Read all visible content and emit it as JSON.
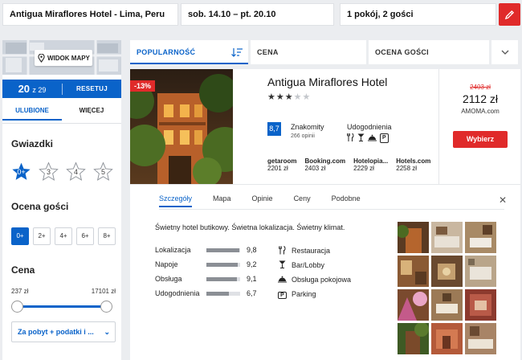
{
  "search": {
    "location": "Antigua Miraflores Hotel - Lima, Peru",
    "dates": "sob. 14.10  –  pt. 20.10",
    "rooms": "1 pokój, 2 gości"
  },
  "sidebar": {
    "map_button": "WIDOK MAPY",
    "count_current": "20",
    "count_total": "z 29",
    "reset_label": "RESETUJ",
    "tabs": [
      {
        "label": "ULUBIONE",
        "active": true
      },
      {
        "label": "WIĘCEJ",
        "active": false
      }
    ],
    "stars_title": "Gwiazdki",
    "stars": [
      "0+",
      "3",
      "4",
      "5"
    ],
    "rating_title": "Ocena gości",
    "ratings": [
      "0+",
      "2+",
      "4+",
      "6+",
      "8+"
    ],
    "price_title": "Cena",
    "price_min": "237 zł",
    "price_max": "17101 zł",
    "price_mode": "Za pobyt + podatki i ..."
  },
  "sort": {
    "popularity": "POPULARNOŚĆ",
    "price": "CENA",
    "rating": "OCENA GOŚCI"
  },
  "hotel": {
    "discount": "-13%",
    "name": "Antigua Miraflores Hotel",
    "stars_on": "★★★",
    "stars_off": "★★",
    "score": "8,7",
    "score_label": "Znakomity",
    "reviews": "266 opinii",
    "amenities_label": "Udogodnienia",
    "alt_prices": [
      {
        "site": "getaroom",
        "price": "2201 zł"
      },
      {
        "site": "Booking.com",
        "price": "2403 zł"
      },
      {
        "site": "Hotelopia...",
        "price": "2229 zł"
      },
      {
        "site": "Hotels.com",
        "price": "2258 zł"
      }
    ],
    "old_price": "2403 zł",
    "price": "2112 zł",
    "provider": "AMOMA.com",
    "select_label": "Wybierz"
  },
  "details": {
    "tabs": [
      "Szczegóły",
      "Mapa",
      "Opinie",
      "Ceny",
      "Podobne"
    ],
    "description": "Świetny hotel butikowy. Świetna lokalizacja. Świetny klimat.",
    "ratings": [
      {
        "name": "Lokalizacja",
        "value": "9,8",
        "fraction": 0.98
      },
      {
        "name": "Napoje",
        "value": "9,2",
        "fraction": 0.92
      },
      {
        "name": "Obsługa",
        "value": "9,1",
        "fraction": 0.91
      },
      {
        "name": "Udogodnienia",
        "value": "6,7",
        "fraction": 0.67
      }
    ],
    "facilities": [
      {
        "icon": "restaurant-icon",
        "label": "Restauracja"
      },
      {
        "icon": "bar-icon",
        "label": "Bar/Lobby"
      },
      {
        "icon": "room-service-icon",
        "label": "Obsługa pokojowa"
      },
      {
        "icon": "parking-icon",
        "label": "Parking"
      }
    ]
  },
  "colors": {
    "accent": "#0a63c9",
    "brand_red": "#e02a2a"
  }
}
